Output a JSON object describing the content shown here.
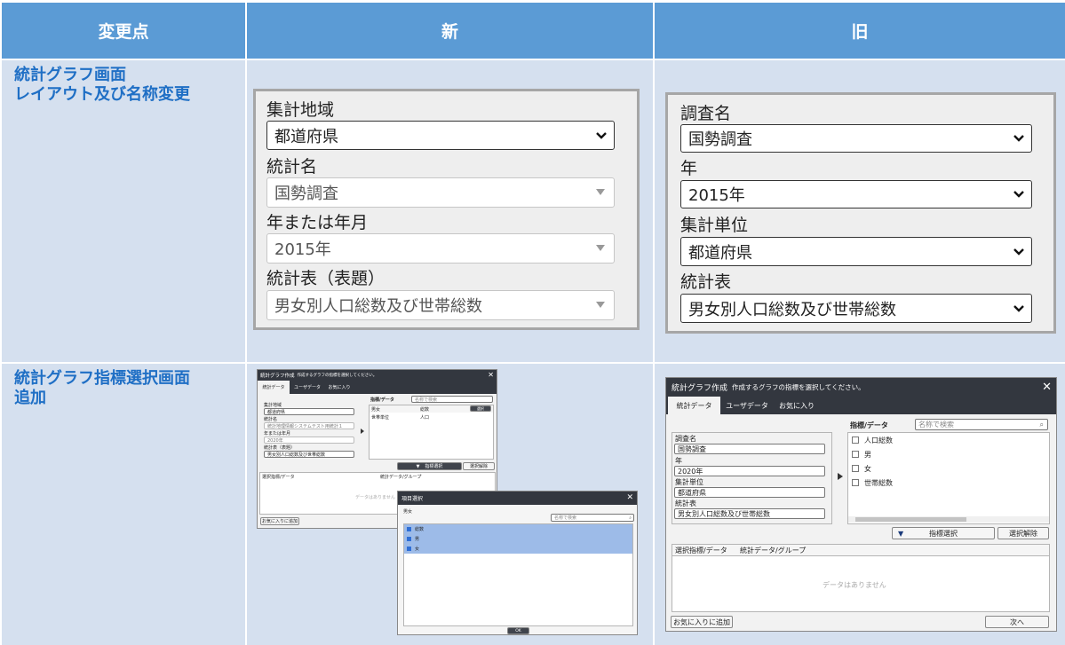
{
  "headers": {
    "col1": "変更点",
    "col2": "新",
    "col3": "旧"
  },
  "rows": [
    {
      "label_lines": [
        "統計グラフ画面",
        "レイアウト及び名称変更"
      ]
    },
    {
      "label_lines": [
        "統計グラフ指標選択画面",
        "追加"
      ]
    }
  ],
  "new_form": {
    "fields": [
      {
        "label": "集計地域",
        "value": "都道府県"
      },
      {
        "label": "統計名",
        "value": "国勢調査"
      },
      {
        "label": "年または年月",
        "value": "2015年"
      },
      {
        "label": "統計表（表題）",
        "value": "男女別人口総数及び世帯総数"
      }
    ]
  },
  "old_form": {
    "fields": [
      {
        "label": "調査名",
        "value": "国勢調査"
      },
      {
        "label": "年",
        "value": "2015年"
      },
      {
        "label": "集計単位",
        "value": "都道府県"
      },
      {
        "label": "統計表",
        "value": "男女別人口総数及び世帯総数"
      }
    ]
  },
  "new_dialog": {
    "title": "統計グラフ作成",
    "subtitle": "作成するグラフの指標を選択してください。",
    "tabs": [
      "統計データ",
      "ユーザデータ",
      "お気に入り"
    ],
    "fields": [
      {
        "label": "集計地域",
        "value": "都道府県"
      },
      {
        "label": "統計名",
        "value": "統計地理情報システムテスト用統計１"
      },
      {
        "label": "年または年月",
        "value": "2020年"
      },
      {
        "label": "統計表（表題）",
        "value": "男女別人口総数及び世帯総数"
      }
    ],
    "indicator_header": "指標/データ",
    "search_placeholder": "名称で検索",
    "list_rows": [
      {
        "c1": "男女",
        "c2": "総数",
        "button": "選択"
      },
      {
        "c1": "世帯単位",
        "c2": "人口",
        "button": ""
      }
    ],
    "select_button": "指標選択",
    "clear_button": "選択解除",
    "selected_col1": "選択指標/データ",
    "selected_col2": "統計データ/グループ",
    "empty_text": "データはありません",
    "favorite_button": "お気に入りに追加"
  },
  "item_dialog": {
    "title": "項目選択",
    "section": "男女",
    "search_placeholder": "名称で検索",
    "items": [
      "総数",
      "男",
      "女"
    ],
    "ok_button": "OK"
  },
  "old_dialog": {
    "title": "統計グラフ作成",
    "subtitle": "作成するグラフの指標を選択してください。",
    "tabs": [
      "統計データ",
      "ユーザデータ",
      "お気に入り"
    ],
    "fields": [
      {
        "label": "調査名",
        "value": "国勢調査"
      },
      {
        "label": "年",
        "value": "2020年"
      },
      {
        "label": "集計単位",
        "value": "都道府県"
      },
      {
        "label": "統計表",
        "value": "男女別人口総数及び世帯総数"
      }
    ],
    "indicator_header": "指標/データ",
    "search_placeholder": "名称で検索",
    "items": [
      "人口総数",
      "男",
      "女",
      "世帯総数"
    ],
    "select_button": "指標選択",
    "clear_button": "選択解除",
    "selected_col1": "選択指標/データ",
    "selected_col2": "統計データ/グループ",
    "empty_text": "データはありません",
    "favorite_button": "お気に入りに追加",
    "next_button": "次へ"
  },
  "colors": {
    "header_bg": "#5b9bd5",
    "cell_bg": "#d5e0ef",
    "label_text": "#1f6fc5",
    "dialog_title": "#33373f"
  },
  "icons": [
    "chevron-down-icon",
    "dropdown-triangle-icon",
    "close-icon",
    "search-icon",
    "arrow-right-icon",
    "arrow-down-icon",
    "checkbox-icon"
  ]
}
